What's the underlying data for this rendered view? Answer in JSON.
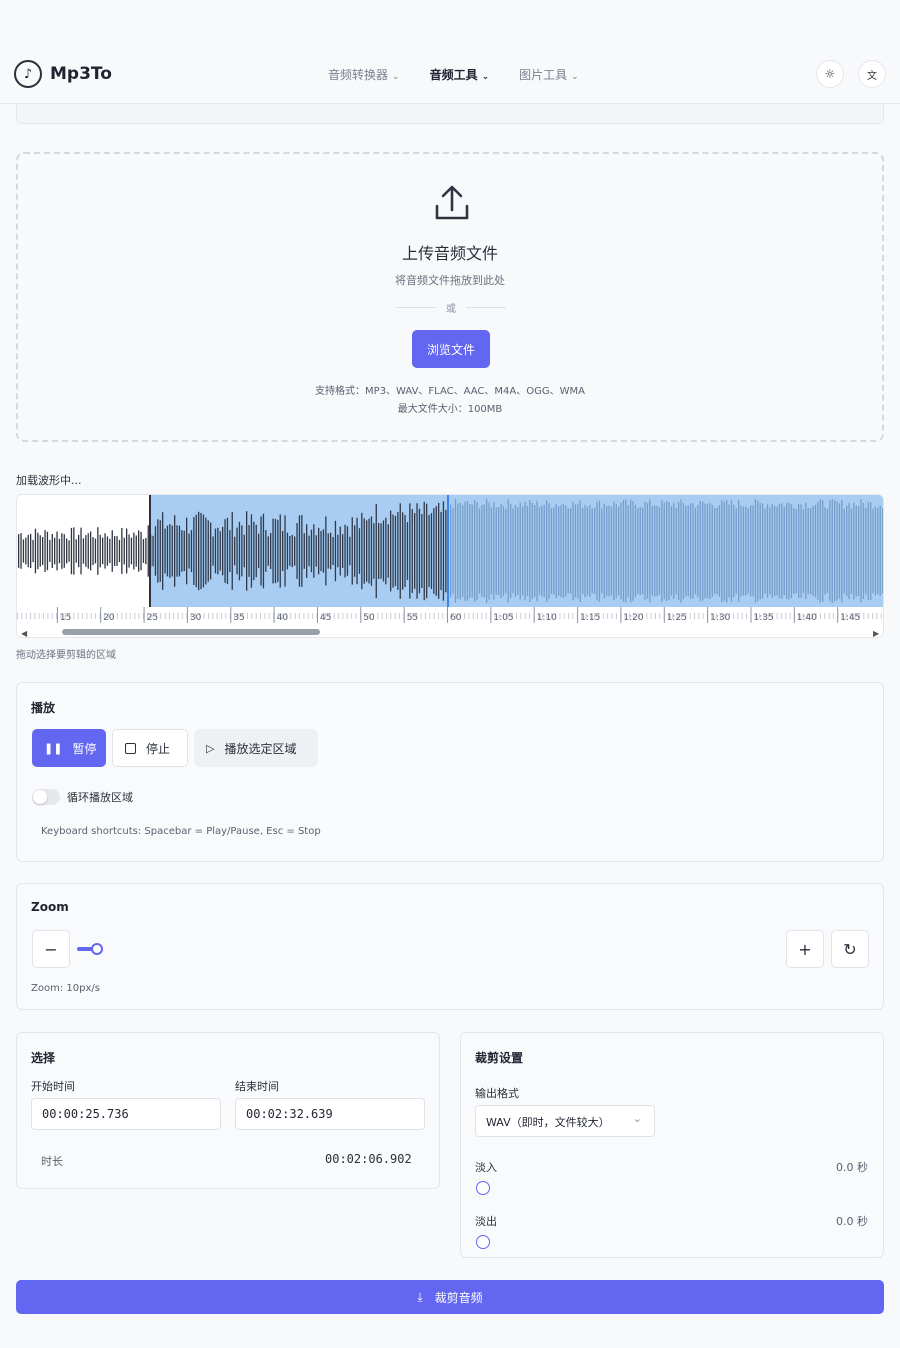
{
  "header": {
    "logo_mark": "♪",
    "logo_text": "Mp3To",
    "nav": [
      {
        "label": "音频转换器",
        "active": false
      },
      {
        "label": "音频工具",
        "active": true
      },
      {
        "label": "图片工具",
        "active": false
      }
    ],
    "chevron": "⌄",
    "theme_icon": "☼",
    "lang_icon": "文"
  },
  "upload": {
    "title": "上传音频文件",
    "subtitle": "将音频文件拖放到此处",
    "or": "或",
    "browse": "浏览文件",
    "formats": "支持格式：MP3、WAV、FLAC、AAC、M4A、OGG、WMA",
    "max_size": "最大文件大小：100MB"
  },
  "waveform": {
    "loading": "加载波形中...",
    "ticks": [
      "15",
      "20",
      "25",
      "30",
      "35",
      "40",
      "45",
      "50",
      "55",
      "60",
      "1:05",
      "1:10",
      "1:15",
      "1:20",
      "1:25",
      "1:30",
      "1:35",
      "1:40",
      "1:45"
    ],
    "drag_hint": "拖动选择要剪辑的区域",
    "progress_position_s": 60,
    "selection_start_s": 25.736
  },
  "playback": {
    "title": "播放",
    "pause": "暂停",
    "stop": "停止",
    "play_selection": "播放选定区域",
    "loop": "循环播放区域",
    "shortcuts": "Keyboard shortcuts: Spacebar = Play/Pause, Esc = Stop"
  },
  "zoom": {
    "title": "Zoom",
    "minus": "−",
    "plus": "+",
    "reset": "↻",
    "value": "Zoom: 10px/s"
  },
  "selection": {
    "title": "选择",
    "start_label": "开始时间",
    "start_value": "00:00:25.736",
    "end_label": "结束时间",
    "end_value": "00:02:32.639",
    "duration_label": "时长",
    "duration_value": "00:02:06.902"
  },
  "trim": {
    "title": "裁剪设置",
    "format_label": "输出格式",
    "format_value": "WAV（即时，文件较大）",
    "fade_in_label": "淡入",
    "fade_in_value": "0.0 秒",
    "fade_out_label": "淡出",
    "fade_out_value": "0.0 秒"
  },
  "cta": {
    "label": "裁剪音频",
    "icon": "⤓"
  },
  "colors": {
    "accent": "#6366f1",
    "selection": "#a9cdf2",
    "wave": "#2f3540",
    "wave_selected": "#4a76a8"
  }
}
